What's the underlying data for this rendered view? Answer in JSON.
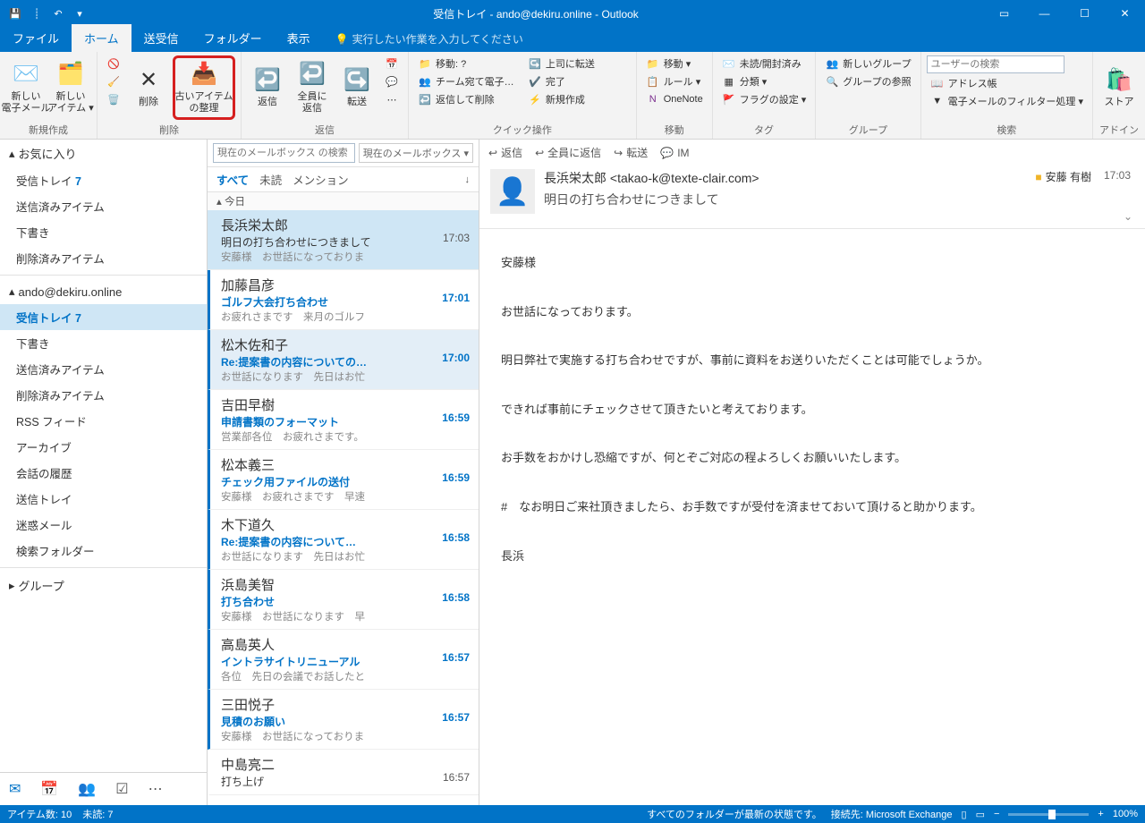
{
  "title": "受信トレイ - ando@dekiru.online - Outlook",
  "qat": {
    "undo": "↶",
    "down": "▾"
  },
  "tabs": {
    "file": "ファイル",
    "home": "ホーム",
    "sendrecv": "送受信",
    "folder": "フォルダー",
    "view": "表示",
    "tellme": "実行したい作業を入力してください"
  },
  "ribbon": {
    "new_email": "新しい\n電子メール",
    "new_items": "新しい\nアイテム ▾",
    "new_group_label": "新規作成",
    "delete": "削除",
    "archive": "古いアイテム\nの整理",
    "delete_group_label": "削除",
    "reply": "返信",
    "reply_all": "全員に\n返信",
    "forward": "転送",
    "reply_group_label": "返信",
    "qs1": "移動: ?",
    "qs2": "チーム宛て電子…",
    "qs3": "返信して削除",
    "qs4": "上司に転送",
    "qs5": "完了",
    "qs6": "新規作成",
    "qs_label": "クイック操作",
    "move": "移動 ▾",
    "rules": "ルール ▾",
    "onenote": "OneNote",
    "move_label": "移動",
    "unread": "未読/開封済み",
    "categorize": "分類 ▾",
    "flag": "フラグの設定 ▾",
    "tag_label": "タグ",
    "new_grp": "新しいグループ",
    "browse_grp": "グループの参照",
    "grp_label": "グループ",
    "search_placeholder": "ユーザーの検索",
    "addressbook": "アドレス帳",
    "filter": "電子メールのフィルター処理 ▾",
    "search_label": "検索",
    "store": "ストア",
    "addin_label": "アドイン"
  },
  "nav": {
    "favorites": "お気に入り",
    "fav_inbox": "受信トレイ",
    "fav_inbox_count": "7",
    "fav_sent": "送信済みアイテム",
    "fav_drafts": "下書き",
    "fav_deleted": "削除済みアイテム",
    "account": "ando@dekiru.online",
    "acc_inbox": "受信トレイ",
    "acc_inbox_count": "7",
    "acc_drafts": "下書き",
    "acc_sent": "送信済みアイテム",
    "acc_deleted": "削除済みアイテム",
    "rss": "RSS フィード",
    "archive": "アーカイブ",
    "conv": "会話の履歴",
    "outbox": "送信トレイ",
    "junk": "迷惑メール",
    "searchf": "検索フォルダー",
    "groups": "グループ"
  },
  "msglist": {
    "search_placeholder": "現在のメールボックス の検索",
    "scope": "現在のメールボックス ▾",
    "tab_all": "すべて",
    "tab_unread": "未読",
    "tab_mention": "メンション",
    "sort": "↓",
    "group_today": "▴ 今日",
    "items": [
      {
        "sender": "長浜栄太郎",
        "subject": "明日の打ち合わせにつきまして",
        "preview": "安藤様　お世話になっておりま",
        "time": "17:03",
        "unread": false,
        "selected": true
      },
      {
        "sender": "加藤昌彦",
        "subject": "ゴルフ大会打ち合わせ",
        "preview": "お疲れさまです　来月のゴルフ",
        "time": "17:01",
        "unread": true
      },
      {
        "sender": "松木佐和子",
        "subject": "Re:提案書の内容についての…",
        "preview": "お世話になります　先日はお忙",
        "time": "17:00",
        "unread": true,
        "focused": true
      },
      {
        "sender": "吉田早樹",
        "subject": "申請書類のフォーマット",
        "preview": "営業部各位　お疲れさまです。",
        "time": "16:59",
        "unread": true
      },
      {
        "sender": "松本義三",
        "subject": "チェック用ファイルの送付",
        "preview": "安藤様　お疲れさまです　早速",
        "time": "16:59",
        "unread": true
      },
      {
        "sender": "木下道久",
        "subject": "Re:提案書の内容について…",
        "preview": "お世話になります　先日はお忙",
        "time": "16:58",
        "unread": true
      },
      {
        "sender": "浜島美智",
        "subject": "打ち合わせ",
        "preview": "安藤様　お世話になります　早",
        "time": "16:58",
        "unread": true
      },
      {
        "sender": "高島英人",
        "subject": "イントラサイトリニューアル",
        "preview": "各位　先日の会議でお話したと",
        "time": "16:57",
        "unread": true
      },
      {
        "sender": "三田悦子",
        "subject": "見積のお願い",
        "preview": "安藤様　お世話になっておりま",
        "time": "16:57",
        "unread": true
      },
      {
        "sender": "中島亮二",
        "subject": "打ち上げ",
        "preview": "",
        "time": "16:57",
        "unread": false
      }
    ]
  },
  "reading": {
    "act_reply": "返信",
    "act_replyall": "全員に返信",
    "act_forward": "転送",
    "act_im": "IM",
    "from": "長浜栄太郎 <takao-k@texte-clair.com>",
    "subject": "明日の打ち合わせにつきまして",
    "category": "安藤 有樹",
    "time": "17:03",
    "body": "安藤様\n\nお世話になっております。\n\n明日弊社で実施する打ち合わせですが、事前に資料をお送りいただくことは可能でしょうか。\n\nできれば事前にチェックさせて頂きたいと考えております。\n\nお手数をおかけし恐縮ですが、何とぞご対応の程よろしくお願いいたします。\n\n#　なお明日ご来社頂きましたら、お手数ですが受付を済ませておいて頂けると助かります。\n\n長浜"
  },
  "status": {
    "items": "アイテム数: 10",
    "unread": "未読: 7",
    "folder_status": "すべてのフォルダーが最新の状態です。",
    "connected": "接続先: Microsoft Exchange",
    "zoom": "100%"
  }
}
